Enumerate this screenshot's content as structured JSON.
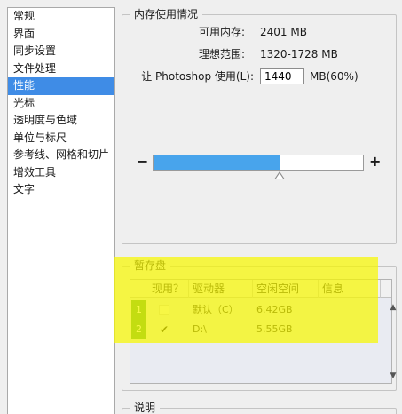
{
  "sidebar": {
    "items": [
      {
        "label": "常规",
        "selected": false
      },
      {
        "label": "界面",
        "selected": false
      },
      {
        "label": "同步设置",
        "selected": false
      },
      {
        "label": "文件处理",
        "selected": false
      },
      {
        "label": "性能",
        "selected": true
      },
      {
        "label": "光标",
        "selected": false
      },
      {
        "label": "透明度与色域",
        "selected": false
      },
      {
        "label": "单位与标尺",
        "selected": false
      },
      {
        "label": "参考线、网格和切片",
        "selected": false
      },
      {
        "label": "增效工具",
        "selected": false
      },
      {
        "label": "文字",
        "selected": false
      }
    ]
  },
  "memory": {
    "title": "内存使用情况",
    "available_label": "可用内存:",
    "available_value": "2401 MB",
    "ideal_label": "理想范围:",
    "ideal_value": "1320-1728 MB",
    "let_label": "让 Photoshop 使用(L):",
    "let_value": "1440",
    "let_suffix": "MB(60%)",
    "minus": "−",
    "plus": "+",
    "slider_fraction": 0.6
  },
  "scratch": {
    "title": "暂存盘",
    "headers": [
      "现用？",
      "驱动器",
      "空闲空间",
      "信息"
    ],
    "rows": [
      {
        "num": "1",
        "active": false,
        "drive": "默认（C）",
        "free": "6.42GB"
      },
      {
        "num": "2",
        "active": true,
        "drive": "D:\\",
        "free": "5.55GB"
      }
    ],
    "check_glyph": "✔"
  },
  "description": {
    "title": "说明"
  },
  "colors": {
    "selection": "#3f8ce6",
    "slider_fill": "#48a4ec",
    "highlight": "#f6f600",
    "row_number": "#3e9a3e"
  },
  "icons": {
    "move_up": "arrow-up-icon",
    "move_down": "arrow-down-icon"
  }
}
